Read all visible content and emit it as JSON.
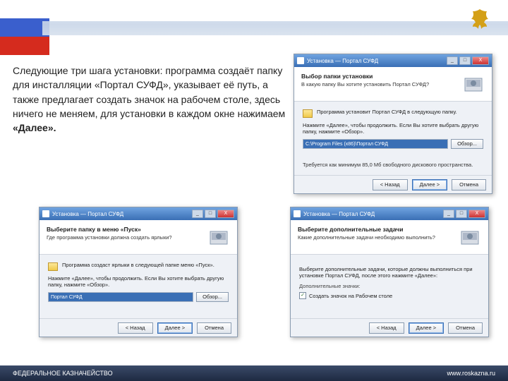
{
  "instruction": {
    "text_before_bold": "Следующие три шага установки: программа создаёт папку для инсталляции «Портал СУФД», указывает её путь, а также предлагает создать значок на рабочем столе, здесь ничего не меняем,  для установки  в каждом окне  нажимаем ",
    "bold": "«Далее»."
  },
  "win_title": "Установка — Портал СУФД",
  "btns": {
    "min": "_",
    "max": "□",
    "close": "X",
    "back": "< Назад",
    "next": "Далее >",
    "cancel": "Отмена",
    "browse": "Обзор..."
  },
  "w1": {
    "title": "Выбор папки установки",
    "sub": "В какую папку Вы хотите установить Портал СУФД?",
    "line1": "Программа установит Портал СУФД в следующую папку.",
    "hint": "Нажмите «Далее», чтобы продолжить. Если Вы хотите выбрать другую папку, нажмите «Обзор».",
    "path": "C:\\Program Files (x86)\\Портал СУФД",
    "space": "Требуется как минимум 85,0 Мб свободного дискового пространства."
  },
  "w2": {
    "title": "Выберите папку в меню «Пуск»",
    "sub": "Где программа установки должна создать ярлыки?",
    "line1": "Программа создаст ярлыки в следующей папке меню «Пуск».",
    "hint": "Нажмите «Далее», чтобы продолжить. Если Вы хотите выбрать другую папку, нажмите «Обзор».",
    "path": "Портал СУФД"
  },
  "w3": {
    "title": "Выберите дополнительные задачи",
    "sub": "Какие дополнительные задачи необходимо выполнить?",
    "hint": "Выберите дополнительные задачи, которые должны выполниться при установке Портал СУФД, после этого нажмите «Далее»:",
    "section": "Дополнительные значки:",
    "check": "✓",
    "cblabel": "Создать значок на Рабочем столе"
  },
  "footer": {
    "org": "ФЕДЕРАЛЬНОЕ КАЗНАЧЕЙСТВО",
    "url": "www.roskazna.ru"
  }
}
